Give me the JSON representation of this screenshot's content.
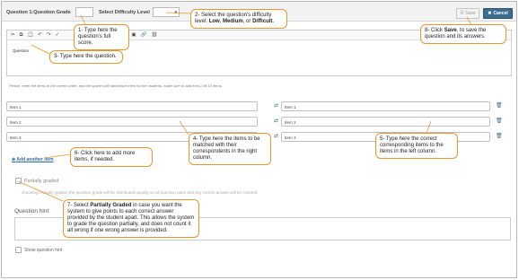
{
  "header": {
    "question_label": "Question 1:Question Grade",
    "difficulty_label": "Select Difficulty Level",
    "save_label": "Save",
    "cancel_label": "Cancel"
  },
  "editor": {
    "text": "Question"
  },
  "items_note": "Please, enter the items in the correct order, and the system will randomize them for the students, make sure to add from 2 till 10 items.",
  "left_items": [
    "Item 1",
    "Item 2",
    "Item 3"
  ],
  "right_items": [
    "Item 1",
    "Item 2",
    "Item 3"
  ],
  "add_another": "Add another item",
  "partial": {
    "label": "Partially graded",
    "note": "choosing Partially graded, the question grade will be distributed equally on all question parts and any correct answer will be counted."
  },
  "hint": {
    "label": "Question hint",
    "show_label": "Show question hint"
  },
  "callouts": {
    "c1": "1- Type here the question's full score.",
    "c2_prefix": "2- Select the question's difficulty level:",
    "c2_low": "Low",
    "c2_medium": "Medium",
    "c2_or": "or",
    "c2_difficult": "Difficult",
    "c3": "3- Type here the question.",
    "c4": "4- Type here the items to be matched with their correspondents in the right column.",
    "c5": "5- Type here the correct corresponding items to the items in the left column.",
    "c6": "6- Click here to add more items, if needed.",
    "c7_prefix": "7- Select",
    "c7_bold": "Partially Graded",
    "c7_rest": "in case you want the system to give points to each correct answer provided by the student apart. This allows the system to grade the question partially, and does not count it all wrong if one wrong answer is provided.",
    "c8_prefix": "8- Click",
    "c8_bold": "Save",
    "c8_rest": ", to save the question and its answers."
  },
  "colors": {
    "accent": "#3d6c8f",
    "callout_border": "#e8962c",
    "link": "#2d6aa5"
  }
}
